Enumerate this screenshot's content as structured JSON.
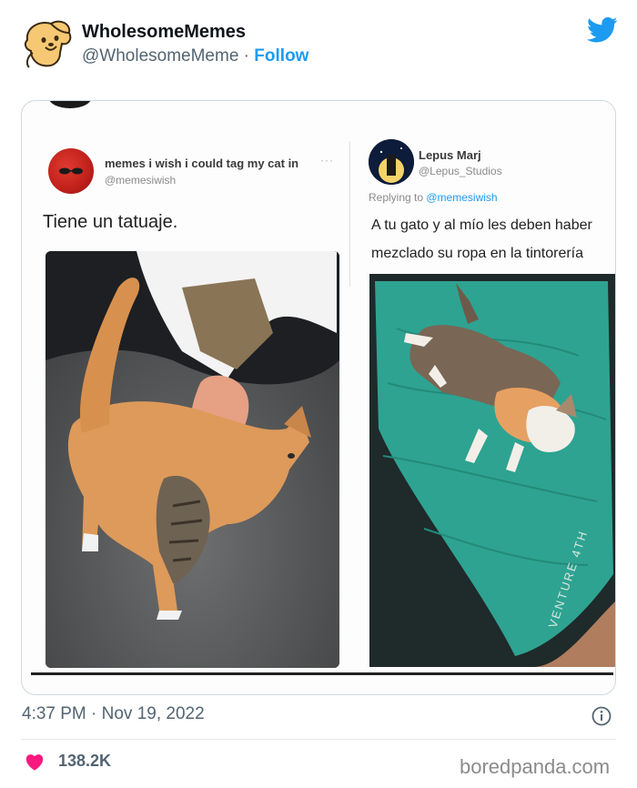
{
  "account": {
    "display_name": "WholesomeMemes",
    "handle": "@WholesomeMeme",
    "separator": " · ",
    "follow_label": "Follow"
  },
  "embedded": {
    "left_tweet": {
      "name": "memes i wish i could tag my cat in",
      "handle": "@memesiwish",
      "more": "···",
      "text": "Tiene un tatuaje."
    },
    "right_tweet": {
      "name": "Lepus Marj",
      "handle": "@Lepus_Studios",
      "replying_prefix": "Replying to ",
      "replying_handle": "@memesiwish",
      "text": "A tu gato y al mío les deben haber mezclado su ropa en la tintorería",
      "mat_brand": "VENTURE 4TH"
    }
  },
  "footer": {
    "timestamp": "4:37 PM · Nov 19, 2022",
    "likes": "138.2K",
    "watermark": "boredpanda.com"
  },
  "icons": {
    "brand": "twitter-bird-icon",
    "info": "info-icon",
    "like": "heart-icon"
  },
  "colors": {
    "accent": "#1d9bf0",
    "like": "#f91880",
    "muted": "#536471"
  }
}
